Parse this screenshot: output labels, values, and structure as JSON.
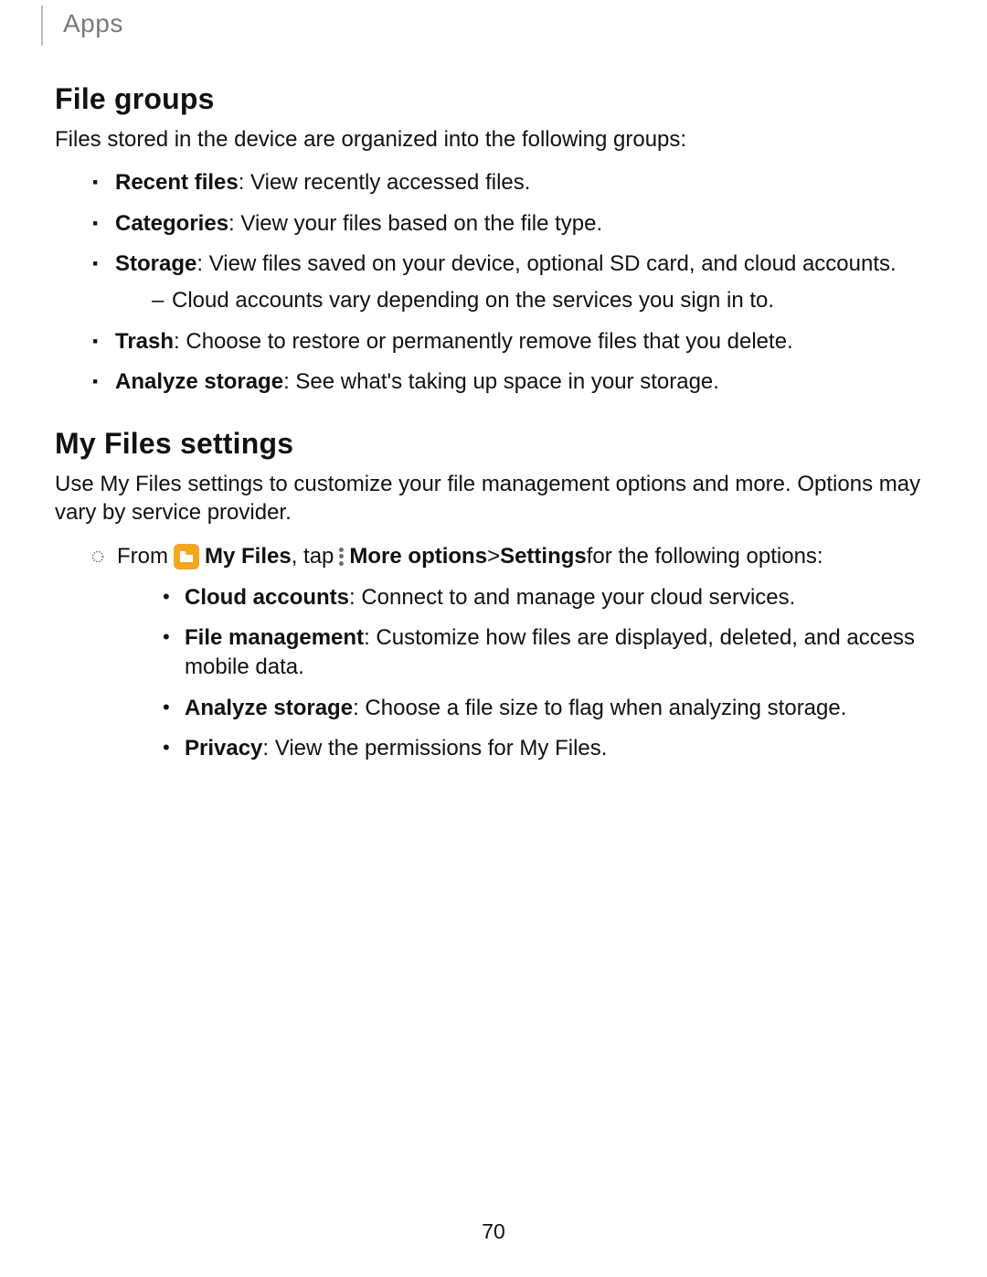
{
  "breadcrumb": "Apps",
  "page_number": "70",
  "section1": {
    "heading": "File groups",
    "intro": "Files stored in the device are organized into the following groups:",
    "items": [
      {
        "term": "Recent files",
        "desc": ": View recently accessed files."
      },
      {
        "term": "Categories",
        "desc": ": View your files based on the file type."
      },
      {
        "term": "Storage",
        "desc": ": View files saved on your device, optional SD card, and cloud accounts.",
        "sub": [
          "Cloud accounts vary depending on the services you sign in to."
        ]
      },
      {
        "term": "Trash",
        "desc": ": Choose to restore or permanently remove files that you delete."
      },
      {
        "term": "Analyze storage",
        "desc": ": See what's taking up space in your storage."
      }
    ]
  },
  "section2": {
    "heading": "My Files settings",
    "intro": "Use My Files settings to customize your file management options and more. Options may vary by service provider.",
    "instruction": {
      "pre": "From",
      "app": "My Files",
      "mid1": ", tap",
      "more": "More options",
      "sep": " > ",
      "settings": "Settings",
      "post": " for the following options:"
    },
    "items": [
      {
        "term": "Cloud accounts",
        "desc": ": Connect to and manage your cloud services."
      },
      {
        "term": "File management",
        "desc": ": Customize how files are displayed, deleted, and access mobile data."
      },
      {
        "term": "Analyze storage",
        "desc": ": Choose a file size to flag when analyzing storage."
      },
      {
        "term": "Privacy",
        "desc": ": View the permissions for My Files."
      }
    ]
  }
}
